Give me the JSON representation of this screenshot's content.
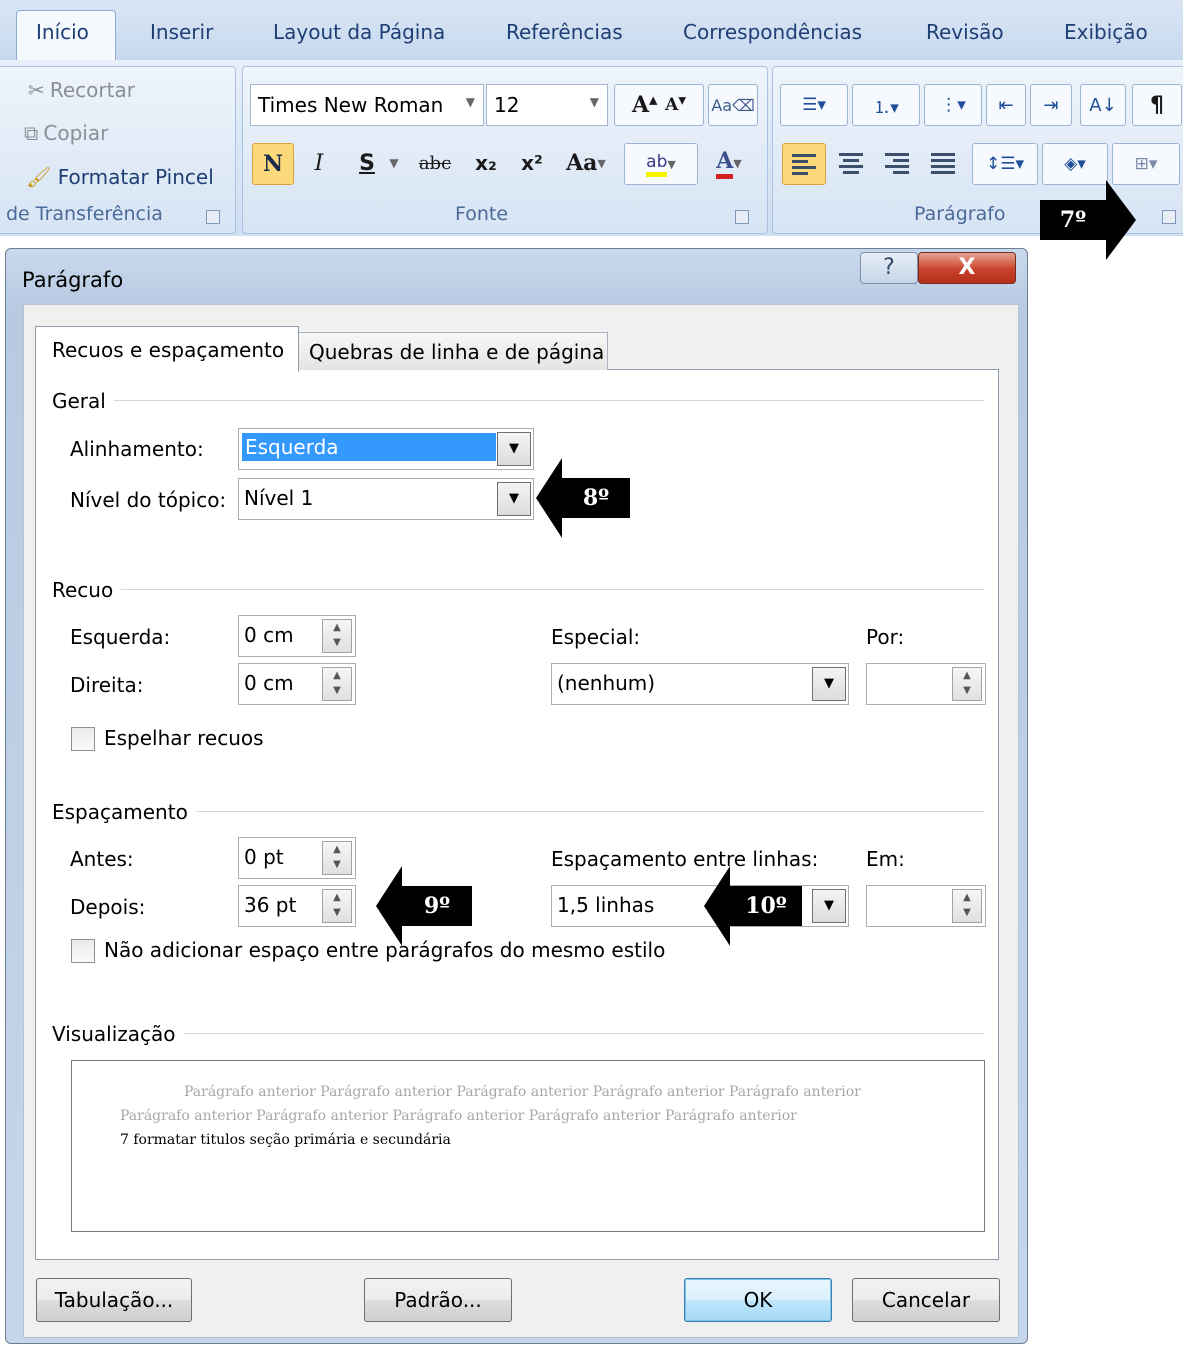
{
  "ribbon": {
    "tabs": [
      "Início",
      "Inserir",
      "Layout da Página",
      "Referências",
      "Correspondências",
      "Revisão",
      "Exibição"
    ],
    "clipboard": {
      "cut": "Recortar",
      "copy": "Copiar",
      "format_painter": "Formatar Pincel",
      "group_label": "de Transferência"
    },
    "font": {
      "family": "Times New Roman",
      "size": "12",
      "bold": "N",
      "italic": "I",
      "underline": "S",
      "strike": "abc",
      "subscript": "x₂",
      "superscript": "x²",
      "change_case": "Aa",
      "color_a": "A",
      "group_label": "Fonte"
    },
    "paragraph": {
      "pilcrow": "¶",
      "group_label": "Parágrafo"
    }
  },
  "annotations": {
    "step7": "7º",
    "step8": "8º",
    "step9": "9º",
    "step10": "10º"
  },
  "dialog": {
    "title": "Parágrafo",
    "help": "?",
    "close": "X",
    "tabs": {
      "indents_spacing": "Recuos e espaçamento",
      "line_page_breaks": "Quebras de linha e de página"
    },
    "general": {
      "heading": "Geral",
      "alignment_label": "Alinhamento:",
      "alignment_value": "Esquerda",
      "outline_label": "Nível do tópico:",
      "outline_value": "Nível 1"
    },
    "indent": {
      "heading": "Recuo",
      "left_label": "Esquerda:",
      "left_value": "0 cm",
      "right_label": "Direita:",
      "right_value": "0 cm",
      "special_label": "Especial:",
      "special_value": "(nenhum)",
      "by_label": "Por:",
      "by_value": "",
      "mirror_label": "Espelhar recuos",
      "mirror_checked": false
    },
    "spacing": {
      "heading": "Espaçamento",
      "before_label": "Antes:",
      "before_value": "0 pt",
      "after_label": "Depois:",
      "after_value": "36 pt",
      "line_spacing_label": "Espaçamento entre linhas:",
      "line_spacing_value": "1,5 linhas",
      "at_label": "Em:",
      "at_value": "",
      "no_space_label": "Não adicionar espaço entre parágrafos do mesmo estilo",
      "no_space_checked": false
    },
    "preview": {
      "heading": "Visualização",
      "line1": "Parágrafo anterior Parágrafo anterior Parágrafo anterior Parágrafo anterior Parágrafo anterior",
      "line2": "Parágrafo anterior Parágrafo anterior Parágrafo anterior Parágrafo anterior Parágrafo anterior",
      "line3": "7 formatar titulos seção primária e secundária"
    },
    "buttons": {
      "tabs": "Tabulação...",
      "default": "Padrão...",
      "ok": "OK",
      "cancel": "Cancelar"
    }
  },
  "colors": {
    "ribbon_text": "#1e3f75",
    "selection": "#3399ff",
    "annotation": "#000000"
  }
}
